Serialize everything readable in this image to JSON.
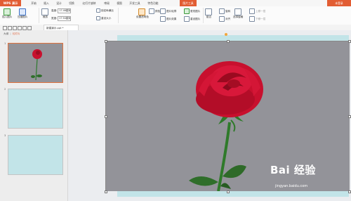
{
  "app": {
    "brand": "WPS 演示",
    "login": "未登录"
  },
  "tabs": [
    "开始",
    "插入",
    "设计",
    "切换",
    "幻灯片放映",
    "审阅",
    "视图",
    "开发工具",
    "特色功能",
    "图片工具"
  ],
  "active_tab": "图片工具",
  "ribbon": {
    "insert_picture": "插入图片",
    "compress": "压缩图片",
    "height_label": "高度:",
    "height_value": "17.46厘米",
    "width_label": "宽度:",
    "width_value": "27.94厘米",
    "lock_ratio": "锁定纵横比",
    "reset_size": "重设大小",
    "crop": "裁剪",
    "set_transparent": "设置透明色",
    "color": "颜色",
    "picture_outline": "图片轮廓",
    "change_picture": "更改图片",
    "picture_effect": "图片效果",
    "reset_picture": "重设图片",
    "combine": "组合",
    "rotate": "旋转",
    "align": "对齐",
    "selection_pane": "选择窗格",
    "bring_forward": "上移一层",
    "send_backward": "下移一层"
  },
  "document": {
    "tab_title": "新建演示.ppt *"
  },
  "panel": {
    "tab_outline": "大纲",
    "tab_slides": "幻灯片"
  },
  "slides": [
    {
      "number": "1"
    },
    {
      "number": "2"
    },
    {
      "number": "3"
    }
  ],
  "watermark": {
    "brand": "Bai 经验",
    "url": "jingyan.baidu.com"
  },
  "colors": {
    "accent": "#e25d33",
    "slide_bg": "#c2e4e8",
    "photo_bg": "#939399",
    "rose": "#c8102e"
  }
}
